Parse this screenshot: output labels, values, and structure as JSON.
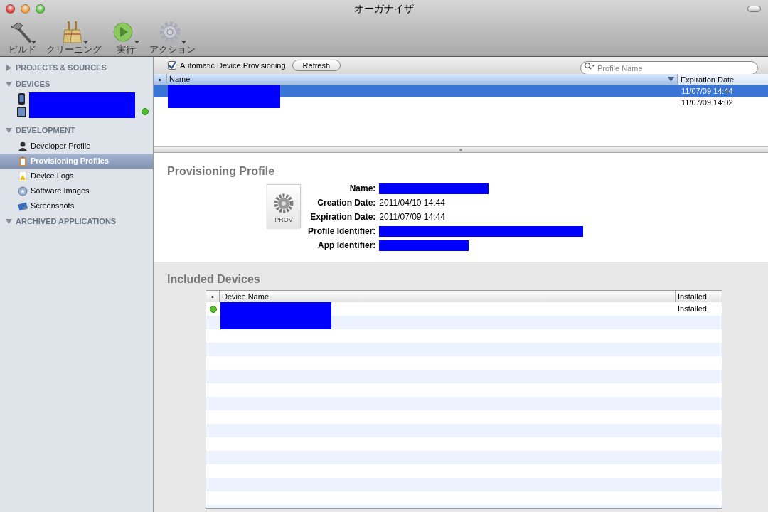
{
  "window": {
    "title": "オーガナイザ"
  },
  "toolbar": [
    {
      "label": "ビルド",
      "kind": "hammer"
    },
    {
      "label": "クリーニング",
      "kind": "broom"
    },
    {
      "label": "実行",
      "kind": "play"
    },
    {
      "label": "アクション",
      "kind": "gear"
    }
  ],
  "sidebar": {
    "sections": [
      {
        "label": "PROJECTS & SOURCES",
        "expanded": false
      },
      {
        "label": "DEVICES",
        "expanded": true,
        "devices": [
          {
            "kind": "phone",
            "connected": false
          },
          {
            "kind": "tablet",
            "connected": true
          }
        ]
      },
      {
        "label": "DEVELOPMENT",
        "expanded": true,
        "items": [
          {
            "label": "Developer Profile",
            "kind": "person",
            "selected": false
          },
          {
            "label": "Provisioning Profiles",
            "kind": "clipboard",
            "selected": true
          },
          {
            "label": "Device Logs",
            "kind": "warning",
            "selected": false
          },
          {
            "label": "Software Images",
            "kind": "disk",
            "selected": false
          },
          {
            "label": "Screenshots",
            "kind": "screenshot",
            "selected": false
          }
        ]
      },
      {
        "label": "ARCHIVED APPLICATIONS",
        "expanded": true
      }
    ]
  },
  "profiles": {
    "auto_provisioning": {
      "label": "Automatic Device Provisioning",
      "checked": true
    },
    "refresh_button": "Refresh",
    "search": {
      "placeholder": "Profile Name"
    },
    "columns": [
      "•",
      "Name",
      "Expiration Date"
    ],
    "rows": [
      {
        "expiration": "11/07/09 14:44",
        "selected": true
      },
      {
        "expiration": "11/07/09 14:02",
        "selected": false
      }
    ]
  },
  "detail": {
    "title": "Provisioning Profile",
    "icon_label": "PROV",
    "fields": [
      {
        "label": "Name:",
        "kind": "redacted"
      },
      {
        "label": "Creation Date:",
        "kind": "text",
        "value": "2011/04/10 14:44"
      },
      {
        "label": "Expiration Date:",
        "kind": "text",
        "value": "2011/07/09 14:44"
      },
      {
        "label": "Profile Identifier:",
        "kind": "redacted"
      },
      {
        "label": "App Identifier:",
        "kind": "redacted"
      }
    ]
  },
  "included_devices": {
    "title": "Included Devices",
    "columns": [
      "•",
      "Device Name",
      "Installed"
    ],
    "rows": [
      {
        "installed": "Installed",
        "color": "#5cc22a"
      }
    ]
  }
}
